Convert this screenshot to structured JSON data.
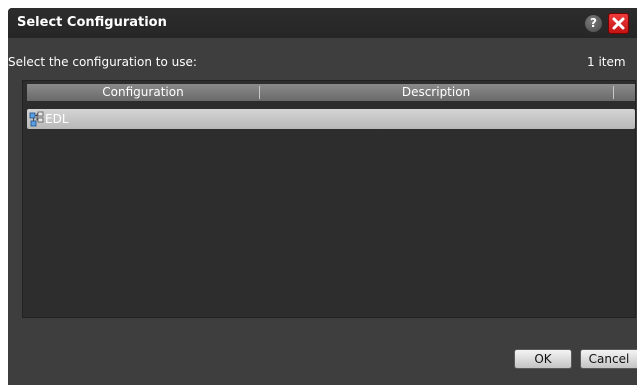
{
  "dialog": {
    "title": "Select Configuration",
    "help_label": "?",
    "prompt": "Select the configuration to use:",
    "item_count": "1 item"
  },
  "list": {
    "columns": [
      "Configuration",
      "Description"
    ],
    "rows": [
      {
        "configuration": "EDL",
        "description": "",
        "icon": "configuration-icon"
      }
    ]
  },
  "buttons": {
    "ok": "OK",
    "cancel": "Cancel"
  },
  "colors": {
    "dialog_background": "#3e3e3e",
    "titlebar": "#2a2a2a",
    "close_button": "#d62222",
    "selected_row": "#c6c6c6"
  }
}
